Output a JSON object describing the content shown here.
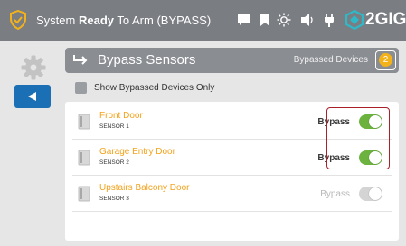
{
  "header": {
    "status_prefix": "System ",
    "status_bold": "Ready",
    "status_suffix": " To Arm (BYPASS)",
    "brand_text": "2GIG",
    "icons": [
      "shield-check-icon",
      "message-icon",
      "bookmark-icon",
      "brightness-icon",
      "volume-icon",
      "plug-icon",
      "brand-logo-icon"
    ]
  },
  "nav": {
    "settings_icon": "gear-icon",
    "back_icon": "back-arrow-icon"
  },
  "titlebar": {
    "title": "Bypass Sensors",
    "bypassed_label": "Bypassed Devices",
    "bypassed_count": "2"
  },
  "filter": {
    "show_bypassed_label": "Show Bypassed Devices Only",
    "checked": false
  },
  "sensors": [
    {
      "name": "Front Door",
      "sensor": "SENSOR 1",
      "bypass_label": "Bypass",
      "bypassed": true
    },
    {
      "name": "Garage Entry Door",
      "sensor": "SENSOR 2",
      "bypass_label": "Bypass",
      "bypassed": true
    },
    {
      "name": "Upstairs Balcony Door",
      "sensor": "SENSOR 3",
      "bypass_label": "Bypass",
      "bypassed": false
    }
  ],
  "colors": {
    "accent_orange": "#f3a21a",
    "toggle_on": "#6cb23e",
    "back_button": "#1b6fb5",
    "highlight": "#a8202a"
  }
}
